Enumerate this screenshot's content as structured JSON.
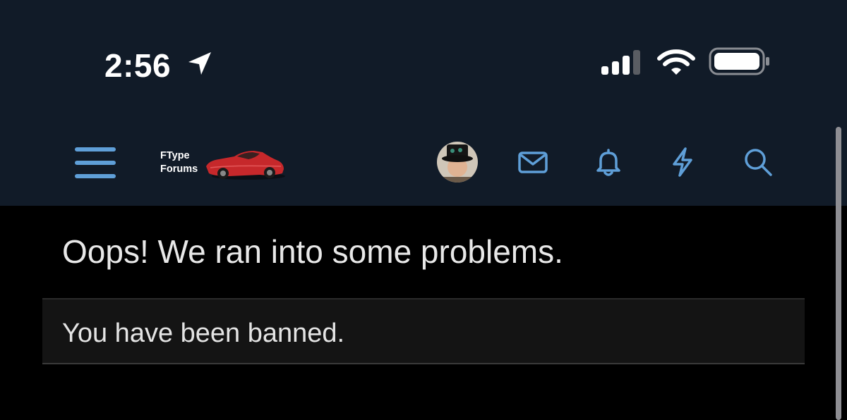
{
  "status_bar": {
    "time": "2:56",
    "icons": [
      "location-arrow-icon",
      "cellular-signal-icon",
      "wifi-icon",
      "battery-icon"
    ],
    "background_color": "#111b28"
  },
  "navbar": {
    "menu_icon": "hamburger-menu-icon",
    "logo": {
      "line1": "FType",
      "line2": "Forums"
    },
    "icons": [
      "user-avatar",
      "mail-icon",
      "bell-icon",
      "bolt-icon",
      "search-icon"
    ],
    "accent_color": "#5f9fd8",
    "background_color": "#111b28"
  },
  "main": {
    "title": "Oops! We ran into some problems.",
    "error_message": "You have been banned."
  }
}
